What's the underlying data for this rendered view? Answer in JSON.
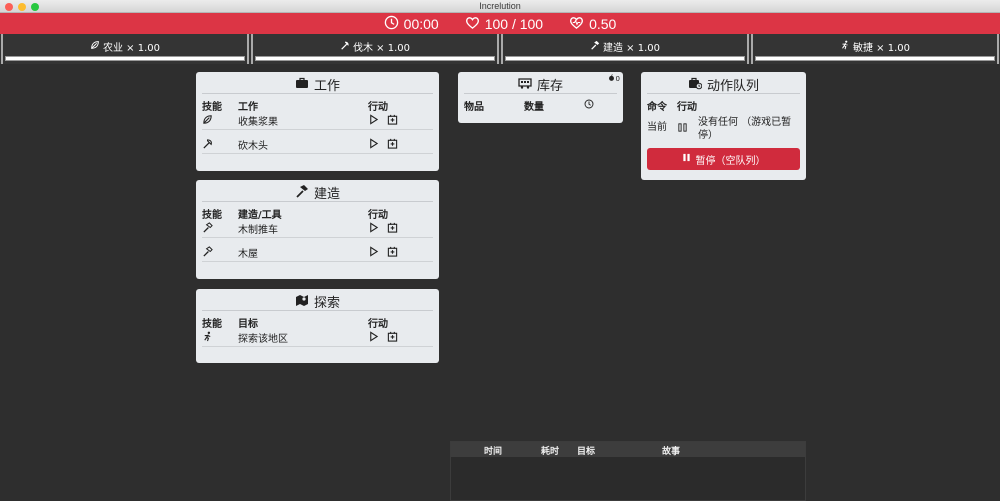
{
  "window": {
    "title": "Increlution"
  },
  "status": {
    "time": "00:00",
    "health": "100 / 100",
    "rate": "0.50"
  },
  "skills": [
    {
      "label": "农业 × 1.00",
      "icon": "leaf-icon"
    },
    {
      "label": "伐木 × 1.00",
      "icon": "axe-icon"
    },
    {
      "label": "建造 × 1.00",
      "icon": "hammer-icon"
    },
    {
      "label": "敏捷 × 1.00",
      "icon": "runner-icon"
    }
  ],
  "work": {
    "title": "工作",
    "headers": {
      "skill": "技能",
      "name": "工作",
      "action": "行动"
    },
    "rows": [
      {
        "name": "收集浆果",
        "skill_icon": "leaf-icon"
      },
      {
        "name": "砍木头",
        "skill_icon": "axe-icon"
      }
    ]
  },
  "build": {
    "title": "建造",
    "headers": {
      "skill": "技能",
      "name": "建造/工具",
      "action": "行动"
    },
    "rows": [
      {
        "name": "木制推车",
        "skill_icon": "hammer-icon"
      },
      {
        "name": "木屋",
        "skill_icon": "hammer-icon"
      }
    ]
  },
  "explore": {
    "title": "探索",
    "headers": {
      "skill": "技能",
      "name": "目标",
      "action": "行动"
    },
    "rows": [
      {
        "name": "探索该地区",
        "skill_icon": "runner-icon"
      }
    ]
  },
  "inventory": {
    "title": "库存",
    "count": "0",
    "headers": {
      "item": "物品",
      "qty": "数量"
    }
  },
  "queue": {
    "title": "动作队列",
    "headers": {
      "cmd": "命令",
      "action": "行动"
    },
    "current_label": "当前",
    "current_text": "没有任何 （游戏已暂停）",
    "pause_button": "暂停（空队列）"
  },
  "log": {
    "headers": {
      "time": "时间",
      "duration": "耗时",
      "target": "目标",
      "story": "故事"
    }
  },
  "colors": {
    "accent": "#dc3545",
    "card": "#e8ebee",
    "background": "#2e2e2e"
  }
}
